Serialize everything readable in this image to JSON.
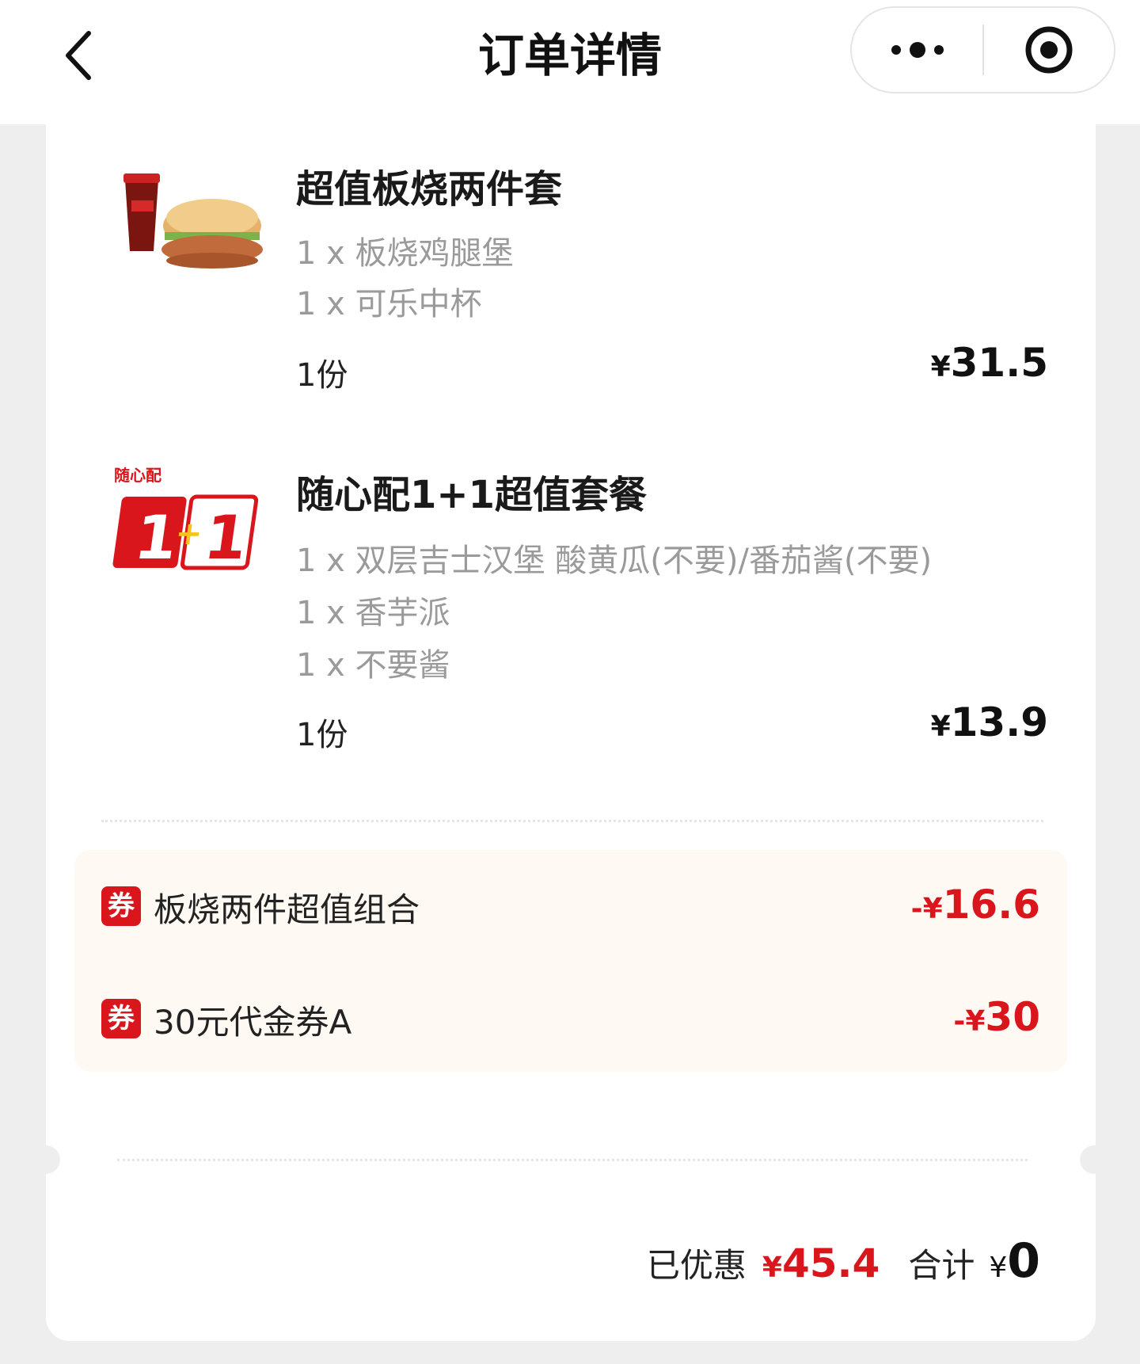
{
  "header": {
    "title": "订单详情"
  },
  "items": [
    {
      "name": "超值板烧两件套",
      "details": [
        "1 x 板烧鸡腿堡",
        "1 x 可乐中杯"
      ],
      "quantity": "1份",
      "currency": "¥",
      "price": "31.5",
      "thumb": "burger-and-cola-image"
    },
    {
      "name": "随心配1+1超值套餐",
      "details": [
        "1 x 双层吉士汉堡 酸黄瓜(不要)/番茄酱(不要)",
        "1 x 香芋派",
        "1 x 不要酱"
      ],
      "quantity": "1份",
      "currency": "¥",
      "price": "13.9",
      "thumb": "combo-1plus1-logo",
      "logo_text": "随心配"
    }
  ],
  "coupons": [
    {
      "tag": "券",
      "name": "板烧两件超值组合",
      "sign": "-",
      "currency": "¥",
      "amount": "16.6"
    },
    {
      "tag": "券",
      "name": "30元代金券A",
      "sign": "-",
      "currency": "¥",
      "amount": "30"
    }
  ],
  "summary": {
    "discount_label": "已优惠",
    "discount_currency": "¥",
    "discount_value": "45.4",
    "total_label": "合计",
    "total_currency": "¥",
    "total_value": "0"
  },
  "colors": {
    "accent": "#d9161c",
    "coupon_bg": "#fff9f3",
    "page_bg": "#eeeeee"
  }
}
